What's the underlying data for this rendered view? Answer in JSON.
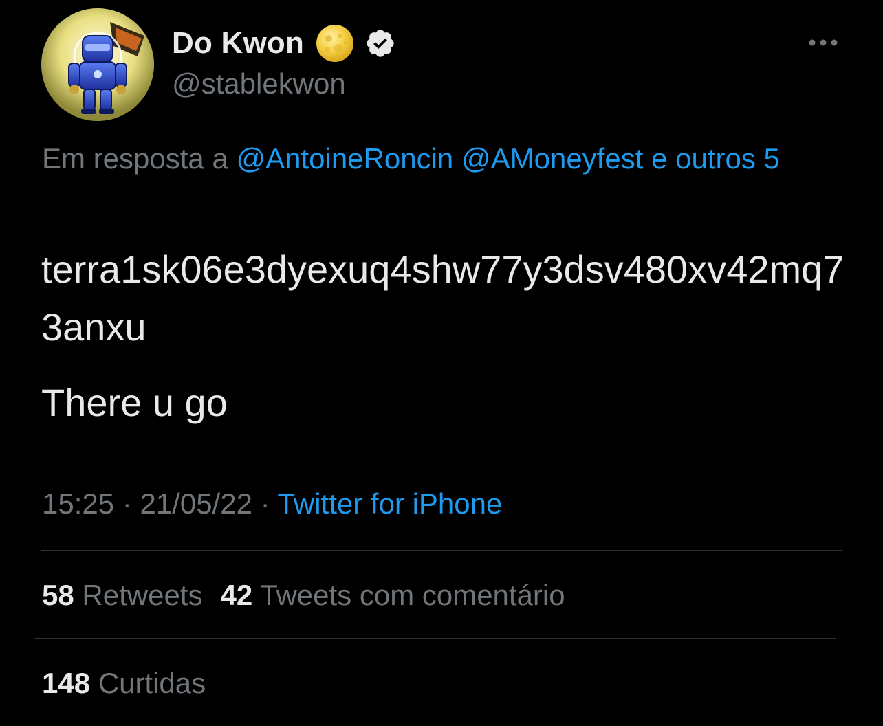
{
  "author": {
    "display_name": "Do Kwon",
    "handle": "@stablekwon",
    "avatar_icon": "robot-avatar",
    "badge_icons": [
      "full-moon-icon",
      "verified-badge-icon"
    ]
  },
  "reply": {
    "prefix": "Em resposta a",
    "mention_1": "@AntoineRoncin",
    "mention_2": "@AMoneyfest",
    "connector": "e",
    "others": "outros 5"
  },
  "tweet": {
    "line_1": "terra1sk06e3dyexuq4shw77y3dsv480xv42mq73anxu",
    "line_2": "There u go"
  },
  "meta": {
    "time": "15:25",
    "separator": "·",
    "date": "21/05/22",
    "source": "Twitter for iPhone"
  },
  "stats": {
    "retweets_count": "58",
    "retweets_label": "Retweets",
    "quotes_count": "42",
    "quotes_label": "Tweets com comentário",
    "likes_count": "148",
    "likes_label": "Curtidas"
  },
  "colors": {
    "background": "#000000",
    "text": "#e7e9ea",
    "secondary": "#71767b",
    "link": "#1d9bf0",
    "divider": "#2f3336"
  }
}
